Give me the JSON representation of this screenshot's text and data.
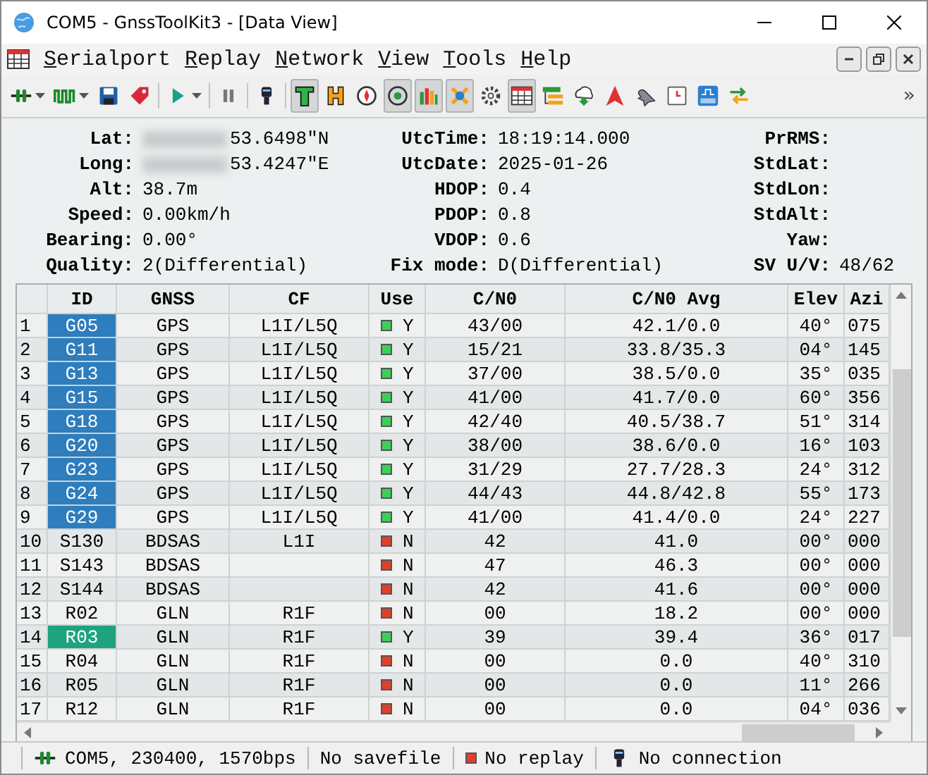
{
  "window": {
    "title": "COM5 - GnssToolKit3 - [Data View]"
  },
  "menu": [
    {
      "mnemonic": "S",
      "rest": "erialport"
    },
    {
      "mnemonic": "R",
      "rest": "eplay"
    },
    {
      "mnemonic": "N",
      "rest": "etwork"
    },
    {
      "mnemonic": "V",
      "rest": "iew"
    },
    {
      "mnemonic": "T",
      "rest": "ools"
    },
    {
      "mnemonic": "H",
      "rest": "elp"
    }
  ],
  "toolbar": {
    "items": [
      {
        "kind": "connect",
        "pressed": false,
        "dropdown": true
      },
      {
        "kind": "signal",
        "pressed": false,
        "dropdown": true
      },
      {
        "kind": "save",
        "pressed": false
      },
      {
        "kind": "tag",
        "pressed": false
      },
      {
        "kind": "separator"
      },
      {
        "kind": "play",
        "pressed": false,
        "dropdown": true
      },
      {
        "kind": "separator"
      },
      {
        "kind": "pause",
        "pressed": false
      },
      {
        "kind": "separator"
      },
      {
        "kind": "plug",
        "pressed": false
      },
      {
        "kind": "separator"
      },
      {
        "kind": "text",
        "pressed": true
      },
      {
        "kind": "hbar",
        "pressed": false
      },
      {
        "kind": "compass",
        "pressed": false
      },
      {
        "kind": "target",
        "pressed": true
      },
      {
        "kind": "bars",
        "pressed": true
      },
      {
        "kind": "satellite",
        "pressed": true
      },
      {
        "kind": "gear",
        "pressed": false
      },
      {
        "kind": "table",
        "pressed": true
      },
      {
        "kind": "tree",
        "pressed": false
      },
      {
        "kind": "download",
        "pressed": false
      },
      {
        "kind": "arrow",
        "pressed": false
      },
      {
        "kind": "bird",
        "pressed": false
      },
      {
        "kind": "clock",
        "pressed": false
      },
      {
        "kind": "pps",
        "pressed": false
      },
      {
        "kind": "swap",
        "pressed": false
      }
    ],
    "overflow": "»"
  },
  "info": [
    {
      "label": "Lat:",
      "value": "53.6498\"N",
      "blurred": true
    },
    {
      "label": "UtcTime:",
      "value": "18:19:14.000"
    },
    {
      "label": "PrRMS:"
    },
    {
      "label": "Long:",
      "value": "53.4247\"E",
      "blurred": true
    },
    {
      "label": "UtcDate:",
      "value": "2025-01-26"
    },
    {
      "label": "StdLat:"
    },
    {
      "label": "Alt:",
      "value": "38.7m"
    },
    {
      "label": "HDOP:",
      "value": "0.4"
    },
    {
      "label": "StdLon:"
    },
    {
      "label": "Speed:",
      "value": "0.00km/h"
    },
    {
      "label": "PDOP:",
      "value": "0.8"
    },
    {
      "label": "StdAlt:"
    },
    {
      "label": "Bearing:",
      "value": "0.00°"
    },
    {
      "label": "VDOP:",
      "value": "0.6"
    },
    {
      "label": "Yaw:"
    },
    {
      "label": "Quality:",
      "value": "2(Differential)"
    },
    {
      "label": "Fix mode:",
      "value": "D(Differential)"
    },
    {
      "label": "SV U/V:",
      "value": "48/62"
    }
  ],
  "table": {
    "columns": [
      "ID",
      "GNSS",
      "CF",
      "Use",
      "C/N0",
      "C/N0 Avg",
      "Elev",
      "Azi"
    ],
    "rows": [
      {
        "index": "1",
        "id": "G05",
        "color": "#2e7dbd",
        "gnss": "GPS",
        "cf": "L1I/L5Q",
        "used": true,
        "use": "Y",
        "cn0": "43/00",
        "avg": "42.1/0.0",
        "elev": "40°",
        "azi": "075"
      },
      {
        "index": "2",
        "id": "G11",
        "color": "#2e7dbd",
        "gnss": "GPS",
        "cf": "L1I/L5Q",
        "used": true,
        "use": "Y",
        "cn0": "15/21",
        "avg": "33.8/35.3",
        "elev": "04°",
        "azi": "145"
      },
      {
        "index": "3",
        "id": "G13",
        "color": "#2e7dbd",
        "gnss": "GPS",
        "cf": "L1I/L5Q",
        "used": true,
        "use": "Y",
        "cn0": "37/00",
        "avg": "38.5/0.0",
        "elev": "35°",
        "azi": "035"
      },
      {
        "index": "4",
        "id": "G15",
        "color": "#2e7dbd",
        "gnss": "GPS",
        "cf": "L1I/L5Q",
        "used": true,
        "use": "Y",
        "cn0": "41/00",
        "avg": "41.7/0.0",
        "elev": "60°",
        "azi": "356"
      },
      {
        "index": "5",
        "id": "G18",
        "color": "#2e7dbd",
        "gnss": "GPS",
        "cf": "L1I/L5Q",
        "used": true,
        "use": "Y",
        "cn0": "42/40",
        "avg": "40.5/38.7",
        "elev": "51°",
        "azi": "314"
      },
      {
        "index": "6",
        "id": "G20",
        "color": "#2e7dbd",
        "gnss": "GPS",
        "cf": "L1I/L5Q",
        "used": true,
        "use": "Y",
        "cn0": "38/00",
        "avg": "38.6/0.0",
        "elev": "16°",
        "azi": "103"
      },
      {
        "index": "7",
        "id": "G23",
        "color": "#2e7dbd",
        "gnss": "GPS",
        "cf": "L1I/L5Q",
        "used": true,
        "use": "Y",
        "cn0": "31/29",
        "avg": "27.7/28.3",
        "elev": "24°",
        "azi": "312"
      },
      {
        "index": "8",
        "id": "G24",
        "color": "#2e7dbd",
        "gnss": "GPS",
        "cf": "L1I/L5Q",
        "used": true,
        "use": "Y",
        "cn0": "44/43",
        "avg": "44.8/42.8",
        "elev": "55°",
        "azi": "173"
      },
      {
        "index": "9",
        "id": "G29",
        "color": "#2e7dbd",
        "gnss": "GPS",
        "cf": "L1I/L5Q",
        "used": true,
        "use": "Y",
        "cn0": "41/00",
        "avg": "41.4/0.0",
        "elev": "24°",
        "azi": "227"
      },
      {
        "index": "10",
        "id": "S130",
        "gnss": "BDSAS",
        "cf": "L1I",
        "used": false,
        "use": "N",
        "cn0": "42",
        "avg": "41.0",
        "elev": "00°",
        "azi": "000"
      },
      {
        "index": "11",
        "id": "S143",
        "gnss": "BDSAS",
        "used": false,
        "use": "N",
        "cn0": "47",
        "avg": "46.3",
        "elev": "00°",
        "azi": "000"
      },
      {
        "index": "12",
        "id": "S144",
        "gnss": "BDSAS",
        "used": false,
        "use": "N",
        "cn0": "42",
        "avg": "41.6",
        "elev": "00°",
        "azi": "000"
      },
      {
        "index": "13",
        "id": "R02",
        "gnss": "GLN",
        "cf": "R1F",
        "used": false,
        "use": "N",
        "cn0": "00",
        "avg": "18.2",
        "elev": "00°",
        "azi": "000"
      },
      {
        "index": "14",
        "id": "R03",
        "color": "#1fa37f",
        "gnss": "GLN",
        "cf": "R1F",
        "used": true,
        "use": "Y",
        "cn0": "39",
        "avg": "39.4",
        "elev": "36°",
        "azi": "017"
      },
      {
        "index": "15",
        "id": "R04",
        "gnss": "GLN",
        "cf": "R1F",
        "used": false,
        "use": "N",
        "cn0": "00",
        "avg": "0.0",
        "elev": "40°",
        "azi": "310"
      },
      {
        "index": "16",
        "id": "R05",
        "gnss": "GLN",
        "cf": "R1F",
        "used": false,
        "use": "N",
        "cn0": "00",
        "avg": "0.0",
        "elev": "11°",
        "azi": "266"
      },
      {
        "index": "17",
        "id": "R12",
        "gnss": "GLN",
        "cf": "R1F",
        "used": false,
        "use": "N",
        "cn0": "00",
        "avg": "0.0",
        "elev": "04°",
        "azi": "036"
      }
    ]
  },
  "status_bar": [
    {
      "kind": "connect",
      "text": "COM5, 230400, 1570bps"
    },
    {
      "kind": "plain",
      "text": "No savefile"
    },
    {
      "kind": "square",
      "text": "No replay"
    },
    {
      "kind": "plug",
      "text": "No connection"
    }
  ]
}
